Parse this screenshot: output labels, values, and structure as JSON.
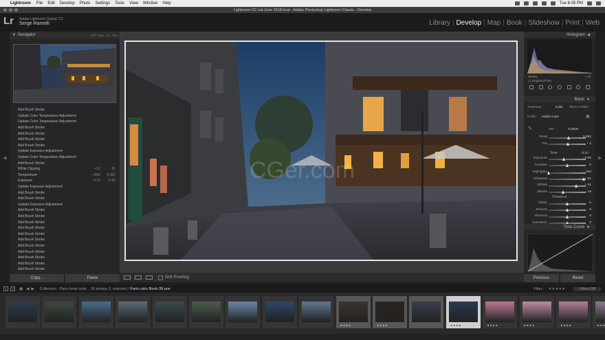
{
  "menu_bar": {
    "app": "Lightroom",
    "items": [
      "File",
      "Edit",
      "Develop",
      "Photo",
      "Settings",
      "Tools",
      "View",
      "Window",
      "Help"
    ],
    "clock": "Tue 6:05 PM"
  },
  "window": {
    "title": "Lightroom CC cat June 2018.lrcat - Adobe Photoshop Lightroom Classic - Develop"
  },
  "identity": {
    "logo": "Lr",
    "product": "Adobe Lightroom Classic CC",
    "user": "Serge Ramelli"
  },
  "modules": [
    {
      "label": "Library"
    },
    {
      "label": "Develop",
      "active": true
    },
    {
      "label": "Map"
    },
    {
      "label": "Book"
    },
    {
      "label": "Slideshow"
    },
    {
      "label": "Print"
    },
    {
      "label": "Web"
    }
  ],
  "navigator": {
    "title": "Navigator",
    "options": [
      "FIT",
      "FILL",
      "1:1",
      "3:1"
    ]
  },
  "history": [
    {
      "label": "Add Brush Stroke"
    },
    {
      "label": "Update Color Temperature Adjustment"
    },
    {
      "label": "Update Color Temperature Adjustment"
    },
    {
      "label": "Add Brush Stroke"
    },
    {
      "label": "Add Brush Stroke"
    },
    {
      "label": "Add Brush Stroke"
    },
    {
      "label": "Add Brush Stroke"
    },
    {
      "label": "Update Exposure Adjustment"
    },
    {
      "label": "Update Color Temperature Adjustment"
    },
    {
      "label": "Add Brush Stroke"
    },
    {
      "label": "White Clipping",
      "v1": "+12",
      "v2": "91"
    },
    {
      "label": "Temperature",
      "v1": "+350",
      "v2": "5,582"
    },
    {
      "label": "Exposure",
      "v1": "-0.10",
      "v2": "-0.90"
    },
    {
      "label": "Update Exposure Adjustment"
    },
    {
      "label": "Add Brush Stroke"
    },
    {
      "label": "Add Brush Stroke"
    },
    {
      "label": "Update Exposure Adjustment"
    },
    {
      "label": "Add Brush Stroke"
    },
    {
      "label": "Add Brush Stroke"
    },
    {
      "label": "Add Brush Stroke"
    },
    {
      "label": "Add Brush Stroke"
    },
    {
      "label": "Add Brush Stroke"
    },
    {
      "label": "Add Brush Stroke"
    },
    {
      "label": "Add Brush Stroke"
    },
    {
      "label": "Add Brush Stroke"
    },
    {
      "label": "Add Brush Stroke"
    },
    {
      "label": "Add Brush Stroke"
    },
    {
      "label": "Add Brush Stroke"
    }
  ],
  "left_buttons": {
    "copy": "Copy...",
    "paste": "Paste"
  },
  "toolbar": {
    "soft_proofing": "Soft Proofing"
  },
  "right_panel": {
    "histogram_title": "Histogram",
    "histogram_channel": "Whites",
    "histogram_value": "+ 51",
    "original_photo": "Original Photo",
    "basic_title": "Basic",
    "treatment_label": "Treatment :",
    "treatment_color": "Color",
    "treatment_bw": "Black & White",
    "profile_label": "Profile :",
    "profile_value": "Adobe Color",
    "wb_label": "WB :",
    "wb_value": "Custom",
    "tone_label": "Tone",
    "auto_label": "Auto",
    "presence_label": "Presence",
    "tone_curve_title": "Tone Curve",
    "sliders_wb": [
      {
        "label": "Temp",
        "value": "5,582",
        "pos": 0.55
      },
      {
        "label": "Tint",
        "value": "+ 2",
        "pos": 0.52
      }
    ],
    "sliders_tone": [
      {
        "label": "Exposure",
        "value": "- 0.90",
        "pos": 0.42
      },
      {
        "label": "Contrast",
        "value": "0",
        "pos": 0.5
      }
    ],
    "sliders_tone2": [
      {
        "label": "Highlights",
        "value": "- 100",
        "pos": 0.0
      },
      {
        "label": "Shadows",
        "value": "+ 91",
        "pos": 0.95
      },
      {
        "label": "Whites",
        "value": "+ 51",
        "pos": 0.75
      },
      {
        "label": "Blacks",
        "value": "- 19",
        "pos": 0.4
      }
    ],
    "sliders_presence": [
      {
        "label": "Clarity",
        "value": "0",
        "pos": 0.5
      },
      {
        "label": "Dehaze",
        "value": "0",
        "pos": 0.5
      },
      {
        "label": "Vibrance",
        "value": "0",
        "pos": 0.5
      },
      {
        "label": "Saturation",
        "value": "0",
        "pos": 0.5
      }
    ]
  },
  "right_buttons": {
    "previous": "Previous",
    "reset": "Reset"
  },
  "filmstrip_bar": {
    "page_1": "1",
    "page_2": "2",
    "breadcrumb": "Collection : Paris book color",
    "count": "26 photos /1 selected /",
    "filename": "Paris color Book-39.arw",
    "filter_label": "Filter :",
    "filters_off": "Filters Off"
  },
  "thumbnails": [
    {
      "tone": "#2d3b4e",
      "stars": ""
    },
    {
      "tone": "#3b4a3e",
      "stars": ""
    },
    {
      "tone": "#4a6c8a",
      "stars": ""
    },
    {
      "tone": "#5a6b7a",
      "stars": ""
    },
    {
      "tone": "#3b4a50",
      "stars": ""
    },
    {
      "tone": "#4b5e4a",
      "stars": ""
    },
    {
      "tone": "#6a88a8",
      "stars": ""
    },
    {
      "tone": "#2f4668",
      "stars": ""
    },
    {
      "tone": "#5f7990",
      "stars": ""
    },
    {
      "tone": "#3b342e",
      "stars": "★★★★"
    },
    {
      "tone": "#2a2420",
      "stars": "★★★★"
    },
    {
      "tone": "#3a3e50",
      "stars": ""
    },
    {
      "tone": "#2a3850",
      "stars": "★★★★",
      "selected": true
    },
    {
      "tone": "#b87a94",
      "stars": "★★★★"
    },
    {
      "tone": "#c08ba8",
      "stars": "★★★★"
    },
    {
      "tone": "#b0809a",
      "stars": "★★★★"
    },
    {
      "tone": "#8e7890",
      "stars": "★★★★"
    }
  ],
  "colors": {
    "accent": "#f2f2f2",
    "panel": "#262626",
    "background": "#1e1e1e"
  }
}
